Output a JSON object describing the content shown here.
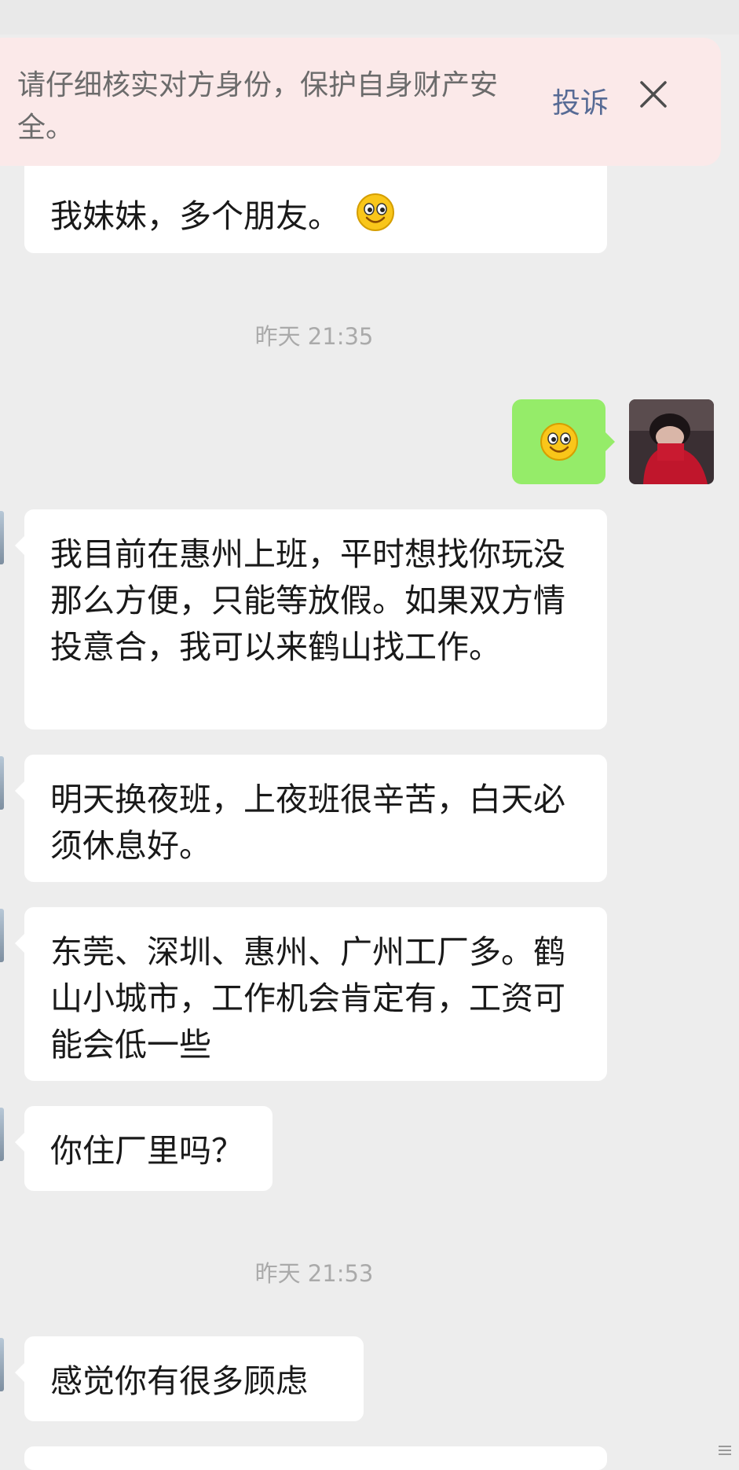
{
  "warning": {
    "text": "请仔细核实对方身份，保护自身财产安全。",
    "report_label": "投诉"
  },
  "messages": [
    {
      "text": "我妹妹，多个朋友。",
      "emoji": "smile-emoji"
    },
    {
      "text": "我目前在惠州上班，平时想找你玩没那么方便，只能等放假。如果双方情投意合，我可以来鹤山找工作。"
    },
    {
      "text": "明天换夜班，上夜班很辛苦，白天必须休息好。"
    },
    {
      "text": "东莞、深圳、惠州、广州工厂多。鹤山小城市，工作机会肯定有，工资可能会低一些"
    },
    {
      "text": "你住厂里吗？"
    },
    {
      "text": "感觉你有很多顾虑"
    }
  ],
  "my_message": {
    "emoji": "smile-emoji"
  },
  "timestamps": [
    "昨天 21:35",
    "昨天 21:53"
  ],
  "colors": {
    "background": "#ededed",
    "warning_bg": "#fbe9e9",
    "my_bubble": "#95ec69",
    "link": "#576b95",
    "timestamp": "#aaaaaa"
  }
}
